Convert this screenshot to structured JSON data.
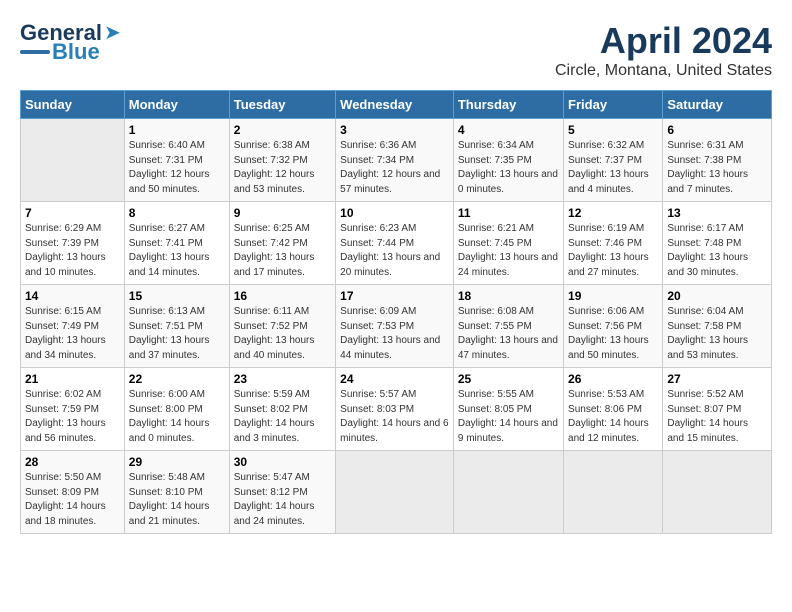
{
  "header": {
    "logo_general": "General",
    "logo_blue": "Blue",
    "main_title": "April 2024",
    "subtitle": "Circle, Montana, United States"
  },
  "calendar": {
    "headers": [
      "Sunday",
      "Monday",
      "Tuesday",
      "Wednesday",
      "Thursday",
      "Friday",
      "Saturday"
    ],
    "weeks": [
      [
        {
          "num": "",
          "sunrise": "",
          "sunset": "",
          "daylight": "",
          "empty": true
        },
        {
          "num": "1",
          "sunrise": "Sunrise: 6:40 AM",
          "sunset": "Sunset: 7:31 PM",
          "daylight": "Daylight: 12 hours and 50 minutes."
        },
        {
          "num": "2",
          "sunrise": "Sunrise: 6:38 AM",
          "sunset": "Sunset: 7:32 PM",
          "daylight": "Daylight: 12 hours and 53 minutes."
        },
        {
          "num": "3",
          "sunrise": "Sunrise: 6:36 AM",
          "sunset": "Sunset: 7:34 PM",
          "daylight": "Daylight: 12 hours and 57 minutes."
        },
        {
          "num": "4",
          "sunrise": "Sunrise: 6:34 AM",
          "sunset": "Sunset: 7:35 PM",
          "daylight": "Daylight: 13 hours and 0 minutes."
        },
        {
          "num": "5",
          "sunrise": "Sunrise: 6:32 AM",
          "sunset": "Sunset: 7:37 PM",
          "daylight": "Daylight: 13 hours and 4 minutes."
        },
        {
          "num": "6",
          "sunrise": "Sunrise: 6:31 AM",
          "sunset": "Sunset: 7:38 PM",
          "daylight": "Daylight: 13 hours and 7 minutes."
        }
      ],
      [
        {
          "num": "7",
          "sunrise": "Sunrise: 6:29 AM",
          "sunset": "Sunset: 7:39 PM",
          "daylight": "Daylight: 13 hours and 10 minutes."
        },
        {
          "num": "8",
          "sunrise": "Sunrise: 6:27 AM",
          "sunset": "Sunset: 7:41 PM",
          "daylight": "Daylight: 13 hours and 14 minutes."
        },
        {
          "num": "9",
          "sunrise": "Sunrise: 6:25 AM",
          "sunset": "Sunset: 7:42 PM",
          "daylight": "Daylight: 13 hours and 17 minutes."
        },
        {
          "num": "10",
          "sunrise": "Sunrise: 6:23 AM",
          "sunset": "Sunset: 7:44 PM",
          "daylight": "Daylight: 13 hours and 20 minutes."
        },
        {
          "num": "11",
          "sunrise": "Sunrise: 6:21 AM",
          "sunset": "Sunset: 7:45 PM",
          "daylight": "Daylight: 13 hours and 24 minutes."
        },
        {
          "num": "12",
          "sunrise": "Sunrise: 6:19 AM",
          "sunset": "Sunset: 7:46 PM",
          "daylight": "Daylight: 13 hours and 27 minutes."
        },
        {
          "num": "13",
          "sunrise": "Sunrise: 6:17 AM",
          "sunset": "Sunset: 7:48 PM",
          "daylight": "Daylight: 13 hours and 30 minutes."
        }
      ],
      [
        {
          "num": "14",
          "sunrise": "Sunrise: 6:15 AM",
          "sunset": "Sunset: 7:49 PM",
          "daylight": "Daylight: 13 hours and 34 minutes."
        },
        {
          "num": "15",
          "sunrise": "Sunrise: 6:13 AM",
          "sunset": "Sunset: 7:51 PM",
          "daylight": "Daylight: 13 hours and 37 minutes."
        },
        {
          "num": "16",
          "sunrise": "Sunrise: 6:11 AM",
          "sunset": "Sunset: 7:52 PM",
          "daylight": "Daylight: 13 hours and 40 minutes."
        },
        {
          "num": "17",
          "sunrise": "Sunrise: 6:09 AM",
          "sunset": "Sunset: 7:53 PM",
          "daylight": "Daylight: 13 hours and 44 minutes."
        },
        {
          "num": "18",
          "sunrise": "Sunrise: 6:08 AM",
          "sunset": "Sunset: 7:55 PM",
          "daylight": "Daylight: 13 hours and 47 minutes."
        },
        {
          "num": "19",
          "sunrise": "Sunrise: 6:06 AM",
          "sunset": "Sunset: 7:56 PM",
          "daylight": "Daylight: 13 hours and 50 minutes."
        },
        {
          "num": "20",
          "sunrise": "Sunrise: 6:04 AM",
          "sunset": "Sunset: 7:58 PM",
          "daylight": "Daylight: 13 hours and 53 minutes."
        }
      ],
      [
        {
          "num": "21",
          "sunrise": "Sunrise: 6:02 AM",
          "sunset": "Sunset: 7:59 PM",
          "daylight": "Daylight: 13 hours and 56 minutes."
        },
        {
          "num": "22",
          "sunrise": "Sunrise: 6:00 AM",
          "sunset": "Sunset: 8:00 PM",
          "daylight": "Daylight: 14 hours and 0 minutes."
        },
        {
          "num": "23",
          "sunrise": "Sunrise: 5:59 AM",
          "sunset": "Sunset: 8:02 PM",
          "daylight": "Daylight: 14 hours and 3 minutes."
        },
        {
          "num": "24",
          "sunrise": "Sunrise: 5:57 AM",
          "sunset": "Sunset: 8:03 PM",
          "daylight": "Daylight: 14 hours and 6 minutes."
        },
        {
          "num": "25",
          "sunrise": "Sunrise: 5:55 AM",
          "sunset": "Sunset: 8:05 PM",
          "daylight": "Daylight: 14 hours and 9 minutes."
        },
        {
          "num": "26",
          "sunrise": "Sunrise: 5:53 AM",
          "sunset": "Sunset: 8:06 PM",
          "daylight": "Daylight: 14 hours and 12 minutes."
        },
        {
          "num": "27",
          "sunrise": "Sunrise: 5:52 AM",
          "sunset": "Sunset: 8:07 PM",
          "daylight": "Daylight: 14 hours and 15 minutes."
        }
      ],
      [
        {
          "num": "28",
          "sunrise": "Sunrise: 5:50 AM",
          "sunset": "Sunset: 8:09 PM",
          "daylight": "Daylight: 14 hours and 18 minutes."
        },
        {
          "num": "29",
          "sunrise": "Sunrise: 5:48 AM",
          "sunset": "Sunset: 8:10 PM",
          "daylight": "Daylight: 14 hours and 21 minutes."
        },
        {
          "num": "30",
          "sunrise": "Sunrise: 5:47 AM",
          "sunset": "Sunset: 8:12 PM",
          "daylight": "Daylight: 14 hours and 24 minutes."
        },
        {
          "num": "",
          "sunrise": "",
          "sunset": "",
          "daylight": "",
          "empty": true
        },
        {
          "num": "",
          "sunrise": "",
          "sunset": "",
          "daylight": "",
          "empty": true
        },
        {
          "num": "",
          "sunrise": "",
          "sunset": "",
          "daylight": "",
          "empty": true
        },
        {
          "num": "",
          "sunrise": "",
          "sunset": "",
          "daylight": "",
          "empty": true
        }
      ]
    ]
  }
}
